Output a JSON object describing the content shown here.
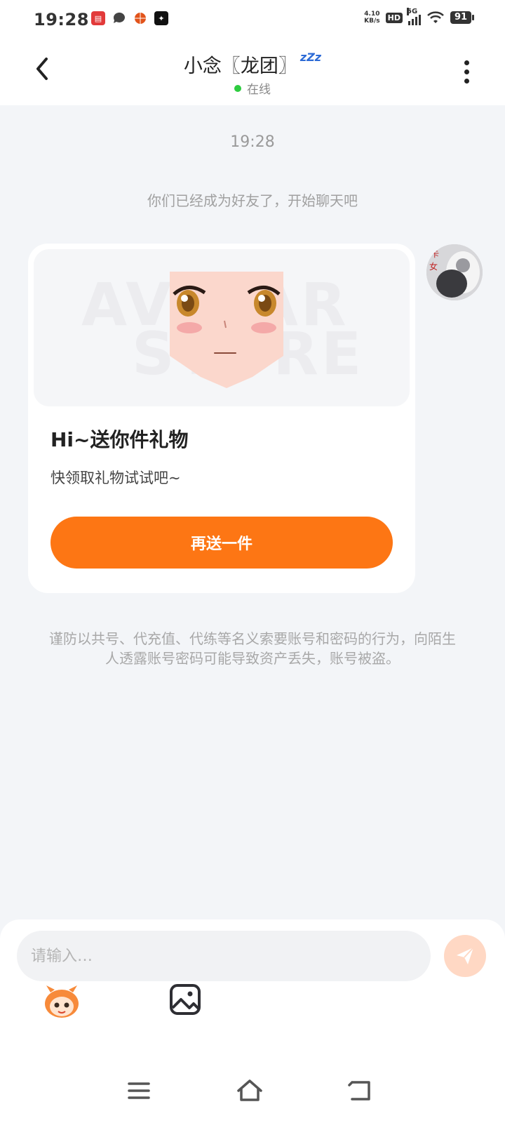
{
  "status_bar": {
    "time": "19:28",
    "net_speed_value": "4.10",
    "net_speed_unit": "KB/s",
    "hd_badge": "HD",
    "network_type": "5G",
    "battery": "91",
    "left_icons": [
      "app-notification-icon",
      "message-icon",
      "basketball-app-icon",
      "star-app-icon"
    ],
    "right_icons": [
      "hd-icon",
      "signal-icon",
      "wifi-icon",
      "battery-icon"
    ]
  },
  "header": {
    "title": "小念〖龙团〗",
    "sleep_badge": "zZz",
    "status": "在线",
    "status_color": "#2ecc40"
  },
  "chat": {
    "timestamp": "19:28",
    "system_message": "你们已经成为好友了，开始聊天吧",
    "card": {
      "watermark_line1": "AVATAR",
      "watermark_line2": "STORE",
      "title": "Hi~送你件礼物",
      "subtitle": "快领取礼物试试吧~",
      "button_label": "再送一件",
      "button_color": "#fd7614"
    },
    "warning": "谨防以共号、代充值、代练等名义索要账号和密码的行为，向陌生人透露账号密码可能导致资产丢失，账号被盗。"
  },
  "input": {
    "placeholder": "请输入…",
    "send_icon": "send-icon",
    "tools": [
      "emoji-mascot-icon",
      "image-icon"
    ]
  },
  "nav": {
    "buttons": [
      "menu-icon",
      "home-icon",
      "back-icon"
    ]
  }
}
